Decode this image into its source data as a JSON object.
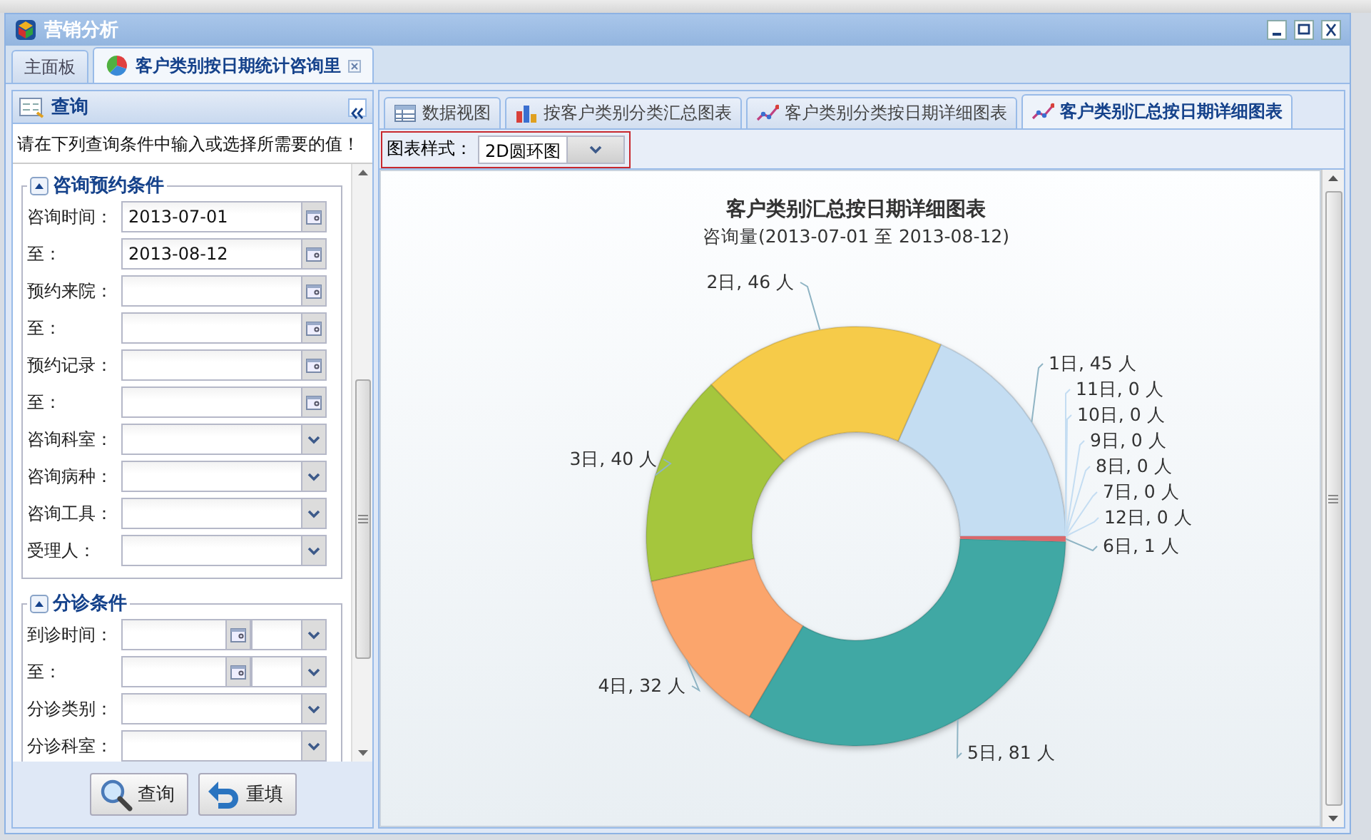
{
  "window": {
    "title": "营销分析"
  },
  "tabs": [
    {
      "label": "主面板",
      "selected": false,
      "closable": false
    },
    {
      "label": "客户类别按日期统计咨询里",
      "selected": true,
      "closable": true
    }
  ],
  "query_panel": {
    "title": "查询",
    "hint": "请在下列查询条件中输入或选择所需要的值！",
    "fieldsets": [
      {
        "legend": "咨询预约条件",
        "expanded": true,
        "fields": [
          {
            "label": "咨询时间：",
            "kind": "date",
            "value": "2013-07-01"
          },
          {
            "label": "至：",
            "kind": "date",
            "value": "2013-08-12"
          },
          {
            "label": "预约来院：",
            "kind": "date"
          },
          {
            "label": "至：",
            "kind": "date"
          },
          {
            "label": "预约记录：",
            "kind": "date"
          },
          {
            "label": "至：",
            "kind": "date"
          },
          {
            "label": "咨询科室：",
            "kind": "combo"
          },
          {
            "label": "咨询病种：",
            "kind": "combo"
          },
          {
            "label": "咨询工具：",
            "kind": "combo"
          },
          {
            "label": "受理人：",
            "kind": "combo"
          }
        ]
      },
      {
        "legend": "分诊条件",
        "expanded": true,
        "fields": [
          {
            "label": "到诊时间：",
            "kind": "datetime"
          },
          {
            "label": "至：",
            "kind": "datetime"
          },
          {
            "label": "分诊类别：",
            "kind": "combo"
          },
          {
            "label": "分诊科室：",
            "kind": "combo"
          }
        ]
      }
    ],
    "buttons": [
      {
        "label": "查询",
        "kind": "search"
      },
      {
        "label": "重填",
        "kind": "reset"
      }
    ]
  },
  "chart_tabs": [
    {
      "label": "数据视图",
      "kind": "table",
      "selected": false
    },
    {
      "label": "按客户类别分类汇总图表",
      "kind": "bar",
      "selected": false
    },
    {
      "label": "客户类别分类按日期详细图表",
      "kind": "line",
      "selected": false
    },
    {
      "label": "客户类别汇总按日期详细图表",
      "kind": "line",
      "selected": true
    }
  ],
  "toolbar": {
    "label": "图表样式：",
    "value": "2D圆环图"
  },
  "chart": {
    "subtitle": "咨询量(2013-07-01 至 2013-08-12)",
    "chart_data": {
      "type": "donut",
      "title": "客户类别汇总按日期详细图表",
      "categories": [
        "1日",
        "2日",
        "3日",
        "4日",
        "5日",
        "6日",
        "7日",
        "8日",
        "9日",
        "10日",
        "11日",
        "12日"
      ],
      "values": [
        45,
        46,
        40,
        32,
        81,
        1,
        0,
        0,
        0,
        0,
        0,
        0
      ],
      "colors": [
        "#c4ddf2",
        "#f6cb4a",
        "#a5c63d",
        "#fba56c",
        "#3fa8a4",
        "#d9686c",
        "#c4ddf2",
        "#c4ddf2",
        "#c4ddf2",
        "#c4ddf2",
        "#c4ddf2",
        "#c4ddf2"
      ],
      "data_labels": true,
      "value_labels": [
        "45 人",
        "46 人",
        "40 人",
        "32 人",
        "81 人",
        "1 人",
        "0 人",
        "0 人",
        "0 人",
        "0 人",
        "0 人",
        "0 人"
      ]
    },
    "label_separator": ", "
  }
}
